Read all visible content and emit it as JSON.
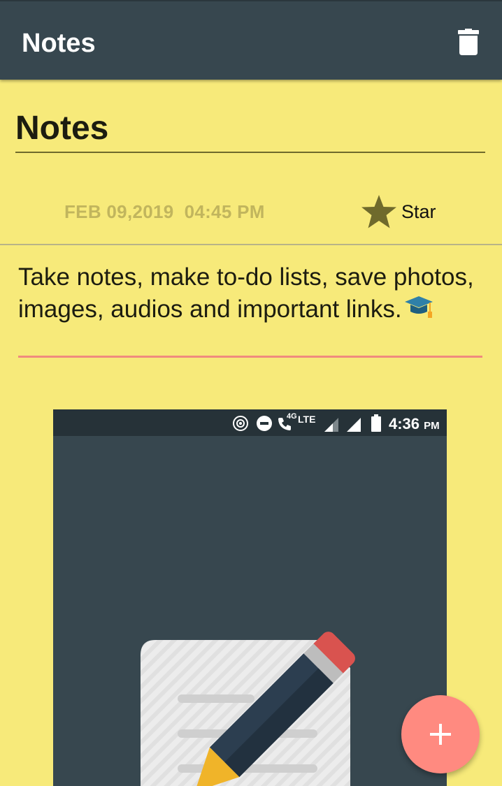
{
  "appbar": {
    "title": "Notes",
    "delete_icon": "trash-icon"
  },
  "note": {
    "title": "Notes",
    "date": "FEB 09,2019",
    "time": "04:45 PM",
    "star_label": "Star",
    "body": "Take notes, make to-do lists, save photos, images, audios and important links.",
    "body_emoji_icon": "graduation-cap-icon"
  },
  "attached_image": {
    "status_time": "4:36",
    "status_ampm": "PM",
    "network_label": "LTE",
    "call_label": "4G"
  },
  "fab": {
    "icon": "plus-icon"
  },
  "colors": {
    "appbar": "#37474f",
    "background": "#f7ea7a",
    "accent": "#ff8a80",
    "star": "#6f6a2c"
  }
}
